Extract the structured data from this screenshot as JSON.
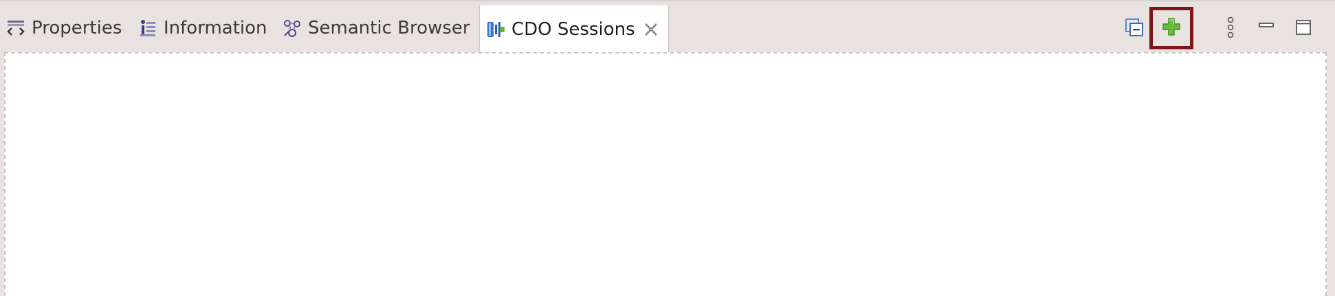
{
  "tabs": [
    {
      "label": "Properties",
      "icon": "properties-icon",
      "active": false
    },
    {
      "label": "Information",
      "icon": "information-icon",
      "active": false
    },
    {
      "label": "Semantic Browser",
      "icon": "semantic-browser-icon",
      "active": false
    },
    {
      "label": "CDO Sessions",
      "icon": "cdo-sessions-icon",
      "active": true
    }
  ],
  "toolbar": {
    "collapse_all": {
      "icon": "collapse-all-icon"
    },
    "add": {
      "icon": "add-icon",
      "color": "#5fb83a",
      "highlight_color": "#7e1518"
    },
    "view_menu": {
      "icon": "view-menu-icon"
    },
    "minimize": {
      "icon": "minimize-icon"
    },
    "maximize": {
      "icon": "maximize-icon"
    }
  },
  "colors": {
    "tabbar_bg": "#e8e3e0",
    "active_tab_bg": "#ffffff",
    "content_bg": "#ffffff"
  }
}
